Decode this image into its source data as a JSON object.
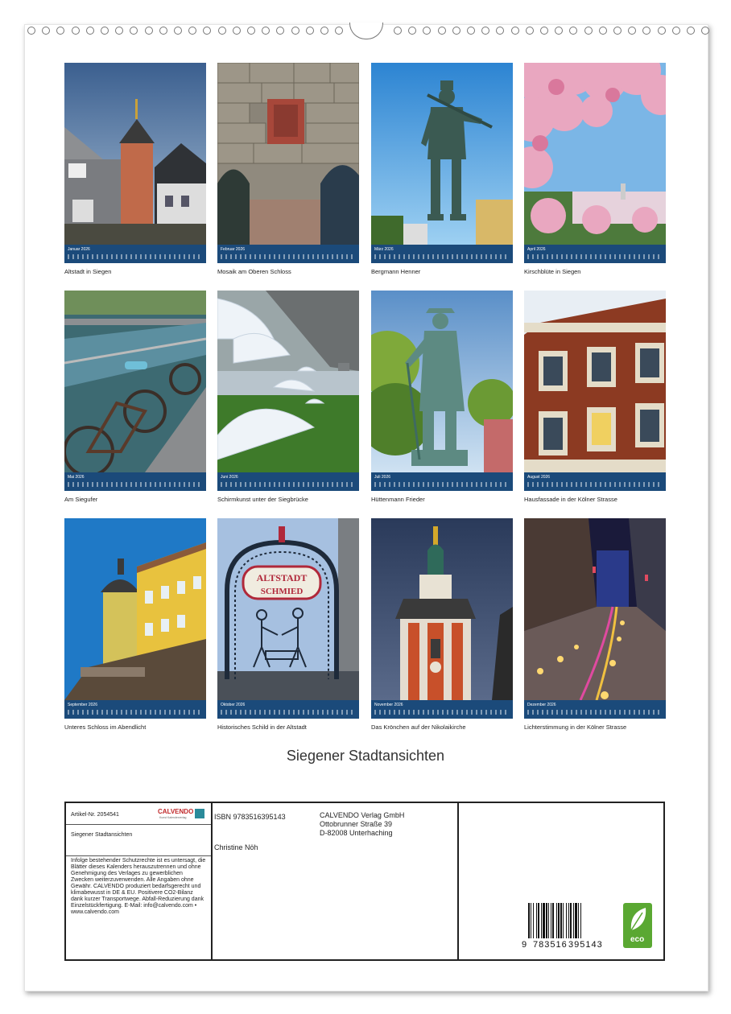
{
  "months": [
    {
      "label": "Januar 2026",
      "caption": "Altstadt in Siegen",
      "icon": "old-town-icon"
    },
    {
      "label": "Februar 2026",
      "caption": "Mosaik am Oberen Schloss",
      "icon": "mosaic-wall-icon"
    },
    {
      "label": "März 2026",
      "caption": "Bergmann Henner",
      "icon": "miner-statue-icon"
    },
    {
      "label": "April 2026",
      "caption": "Kirschblüte in Siegen",
      "icon": "cherry-blossom-icon"
    },
    {
      "label": "Mai 2026",
      "caption": "Am Siegufer",
      "icon": "bicycles-icon"
    },
    {
      "label": "Juni 2026",
      "caption": "Schirmkunst unter der Siegbrücke",
      "icon": "umbrella-art-icon"
    },
    {
      "label": "Juli 2026",
      "caption": "Hüttenmann Frieder",
      "icon": "smelter-statue-icon"
    },
    {
      "label": "August 2026",
      "caption": "Hausfassade in der Kölner Strasse",
      "icon": "facade-icon"
    },
    {
      "label": "September 2026",
      "caption": "Unteres Schloss im Abendlicht",
      "icon": "castle-icon"
    },
    {
      "label": "Oktober 2026",
      "caption": "Historisches Schild in der Altstadt",
      "icon": "sign-icon"
    },
    {
      "label": "November 2026",
      "caption": "Das Krönchen auf der Nikolaikirche",
      "icon": "church-tower-icon"
    },
    {
      "label": "Dezember 2026",
      "caption": "Lichterstimmung in der Kölner Strasse",
      "icon": "street-lights-icon"
    }
  ],
  "sign_text": {
    "line1": "ALTSTADT",
    "line2": "SCHMIED"
  },
  "title": "Siegener Stadtansichten",
  "info": {
    "article_label": "Artikel-Nr. 2054541",
    "brand": "CALVENDO",
    "brand_sub": "Kunst Kalenderverlag",
    "product_title": "Siegener Stadtansichten",
    "legal_text": "Infolge bestehender Schutzrechte ist es untersagt, die Blätter dieses Kalenders herauszutrennen und ohne Genehmigung des Verlages zu gewerblichen Zwecken weiterzuverwenden. Alle Angaben ohne Gewähr. CALVENDO produziert bedarfsgerecht und klimabewusst in DE & EU. Positivere CO2-Bilanz dank kurzer Transportwege. Abfall-Reduzierung dank Einzelstückfertigung. E-Mail: info@calvendo.com • www.calvendo.com",
    "isbn": "ISBN 9783516395143",
    "author": "Christine Nöh",
    "publisher_name": "CALVENDO Verlag GmbH",
    "publisher_street": "Ottobrunner Straße 39",
    "publisher_city": "D-82008 Unterhaching",
    "barcode_first": "9",
    "barcode_left": "783516",
    "barcode_right": "395143",
    "eco_label": "eco"
  },
  "colors": {
    "month_bar": "#1b4a7a",
    "eco_green": "#5aa832"
  }
}
